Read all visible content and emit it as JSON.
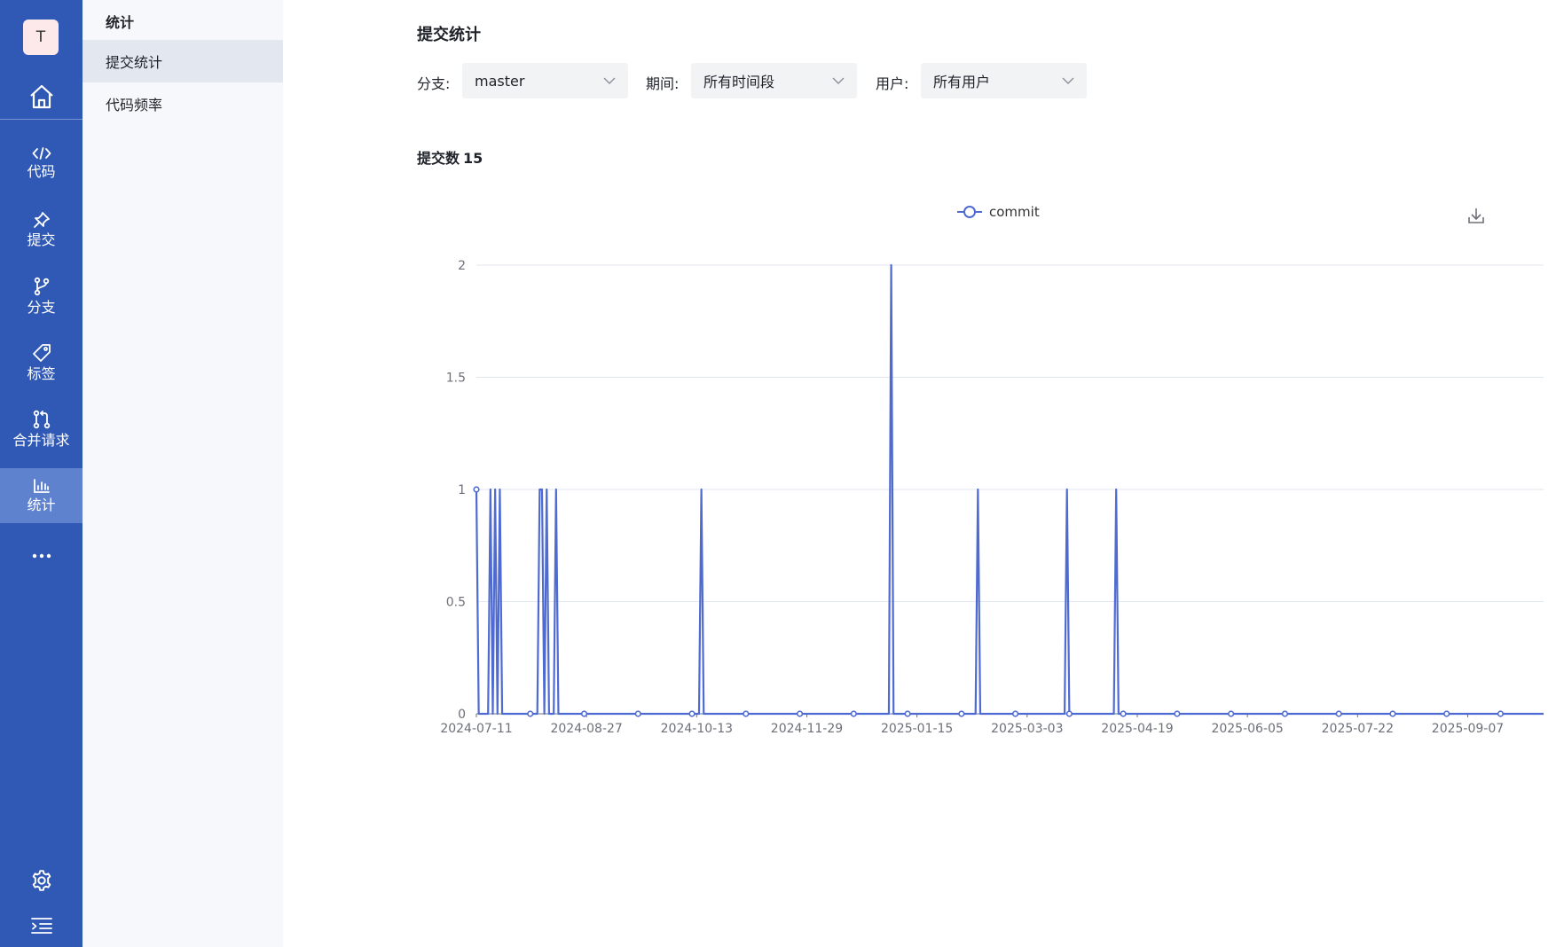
{
  "rail": {
    "avatar_letter": "T",
    "items": [
      {
        "label": "代码",
        "icon": "code-icon"
      },
      {
        "label": "提交",
        "icon": "pin-icon"
      },
      {
        "label": "分支",
        "icon": "branch-icon"
      },
      {
        "label": "标签",
        "icon": "tag-icon"
      },
      {
        "label": "合并请求",
        "icon": "merge-request-icon"
      },
      {
        "label": "统计",
        "icon": "bar-chart-icon"
      }
    ],
    "active": "统计",
    "accent": "#3059b5"
  },
  "submenu": {
    "title": "统计",
    "items": [
      "提交统计",
      "代码频率"
    ],
    "active": "提交统计"
  },
  "main": {
    "title": "提交统计",
    "filters": {
      "branch_label": "分支:",
      "branch_value": "master",
      "period_label": "期间:",
      "period_value": "所有时间段",
      "user_label": "用户:",
      "user_value": "所有用户"
    },
    "commit_count_label": "提交数",
    "commit_count": "15"
  },
  "chart_data": {
    "type": "line",
    "x_type": "date",
    "x_start": "2024-07-11",
    "x_end": "2025-10-23",
    "x_tick_labels": [
      "2024-07-11",
      "2024-08-27",
      "2024-10-13",
      "2024-11-29",
      "2025-01-15",
      "2025-03-03",
      "2025-04-19",
      "2025-06-05",
      "2025-07-22",
      "2025-09-07"
    ],
    "ylim": [
      0,
      2
    ],
    "y_ticks": [
      0,
      0.5,
      1,
      1.5,
      2
    ],
    "grid": true,
    "legend": "top-center",
    "color": "#4f6bd1",
    "series": [
      {
        "name": "commit",
        "points": [
          {
            "date": "2024-07-11",
            "value": 1
          },
          {
            "date": "2024-07-17",
            "value": 1
          },
          {
            "date": "2024-07-19",
            "value": 1
          },
          {
            "date": "2024-07-21",
            "value": 1
          },
          {
            "date": "2024-08-07",
            "value": 1
          },
          {
            "date": "2024-08-08",
            "value": 1
          },
          {
            "date": "2024-08-10",
            "value": 1
          },
          {
            "date": "2024-08-14",
            "value": 1
          },
          {
            "date": "2024-10-15",
            "value": 1
          },
          {
            "date": "2025-01-04",
            "value": 2
          },
          {
            "date": "2025-02-10",
            "value": 1
          },
          {
            "date": "2025-03-20",
            "value": 1
          },
          {
            "date": "2025-04-10",
            "value": 1
          }
        ]
      }
    ]
  }
}
